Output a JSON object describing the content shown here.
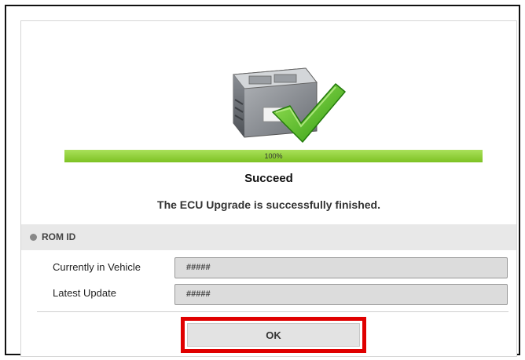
{
  "progress": {
    "percent": 1.0,
    "label": "100%"
  },
  "status": {
    "title": "Succeed",
    "message": "The ECU Upgrade is successfully finished."
  },
  "rom_section": {
    "title": "ROM ID",
    "fields": [
      {
        "label": "Currently in Vehicle",
        "value": "#####"
      },
      {
        "label": "Latest Update",
        "value": "#####"
      }
    ]
  },
  "ok_button": {
    "label": "OK"
  },
  "icons": {
    "hero": "ecu-check-icon",
    "bullet": "bullet-icon"
  },
  "colors": {
    "progress": "#7dc223",
    "highlight": "#e00000",
    "check": "#4cbb17"
  }
}
